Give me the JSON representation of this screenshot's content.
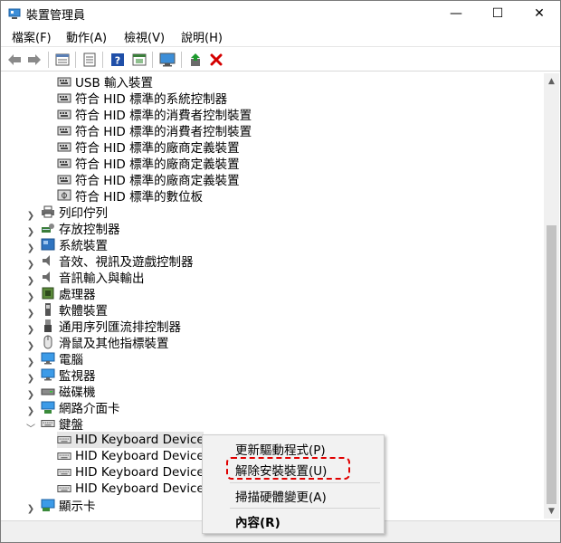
{
  "window": {
    "title": "裝置管理員",
    "controls": {
      "minimize": "—",
      "maximize": "☐",
      "close": "✕"
    }
  },
  "menubar": [
    {
      "label": "檔案(F)"
    },
    {
      "label": "動作(A)"
    },
    {
      "label": "檢視(V)"
    },
    {
      "label": "說明(H)"
    }
  ],
  "toolbar": {
    "icons": [
      "back-arrow-icon",
      "forward-arrow-icon",
      "properties-sheet-icon",
      "view-list-icon",
      "help-icon",
      "refresh-view-icon",
      "monitor-scan-icon",
      "update-driver-icon",
      "uninstall-x-icon"
    ],
    "accent_red": "#d40000"
  },
  "tree": {
    "hid_children": [
      "USB 輸入裝置",
      "符合 HID 標準的系統控制器",
      "符合 HID 標準的消費者控制裝置",
      "符合 HID 標準的消費者控制裝置",
      "符合 HID 標準的廠商定義裝置",
      "符合 HID 標準的廠商定義裝置",
      "符合 HID 標準的廠商定義裝置",
      "符合 HID 標準的數位板"
    ],
    "categories": [
      {
        "label": "列印佇列",
        "icon": "printer-icon"
      },
      {
        "label": "存放控制器",
        "icon": "storage-controller-icon"
      },
      {
        "label": "系統裝置",
        "icon": "system-device-icon"
      },
      {
        "label": "音效、視訊及遊戲控制器",
        "icon": "speaker-icon"
      },
      {
        "label": "音訊輸入與輸出",
        "icon": "speaker-icon"
      },
      {
        "label": "處理器",
        "icon": "processor-icon"
      },
      {
        "label": "軟體裝置",
        "icon": "software-device-icon"
      },
      {
        "label": "通用序列匯流排控制器",
        "icon": "usb-icon"
      },
      {
        "label": "滑鼠及其他指標裝置",
        "icon": "mouse-icon"
      },
      {
        "label": "電腦",
        "icon": "computer-icon"
      },
      {
        "label": "監視器",
        "icon": "monitor-icon"
      },
      {
        "label": "磁碟機",
        "icon": "disk-drive-icon"
      },
      {
        "label": "網路介面卡",
        "icon": "network-adapter-icon"
      }
    ],
    "keyboard": {
      "label": "鍵盤",
      "children": [
        "HID Keyboard Device",
        "HID Keyboard Device",
        "HID Keyboard Device",
        "HID Keyboard Device"
      ]
    },
    "display_adapter": {
      "label": "顯示卡"
    }
  },
  "context_menu": {
    "items": [
      {
        "label": "更新驅動程式(P)"
      },
      {
        "label": "解除安裝裝置(U)",
        "highlighted": true
      },
      {
        "label": "掃描硬體變更(A)"
      },
      {
        "label": "內容(R)",
        "bold": true
      }
    ],
    "highlight_color": "#e00000"
  }
}
